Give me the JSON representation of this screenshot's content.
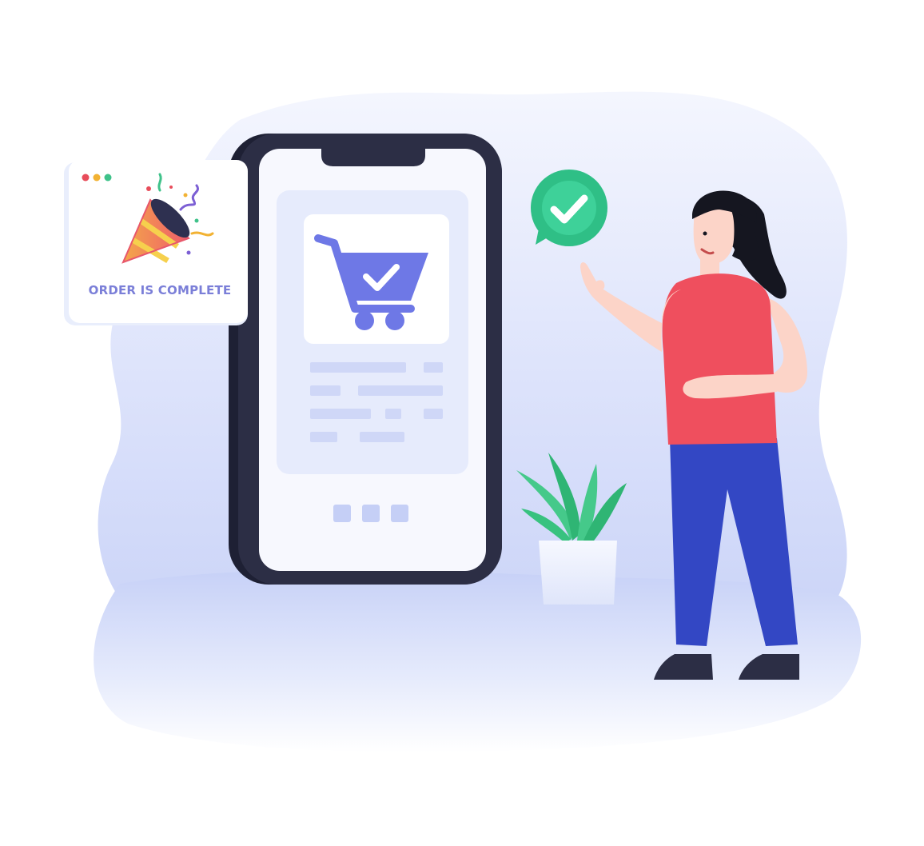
{
  "notification_card": {
    "title": "ORDER IS COMPLETE",
    "text_color": "#7b7fd8",
    "window_dots": [
      "#e84d5b",
      "#f2b233",
      "#3fc28a"
    ]
  },
  "icons": {
    "card": "party-popper-icon",
    "phone_screen": "shopping-cart-check-icon",
    "speech_bubble": "checkmark-icon"
  },
  "colors": {
    "backdrop": "#e3e8fb",
    "phone_frame": "#2c2e45",
    "phone_screen": "#f7f8fe",
    "cart": "#6e78e6",
    "check_badge": "#2fbf86",
    "shirt": "#ef4f5e",
    "pants": "#3347c4",
    "hair": "#151620",
    "skin": "#fcd4c8",
    "plant": "#38c27f",
    "pot": "#eef2fd"
  }
}
